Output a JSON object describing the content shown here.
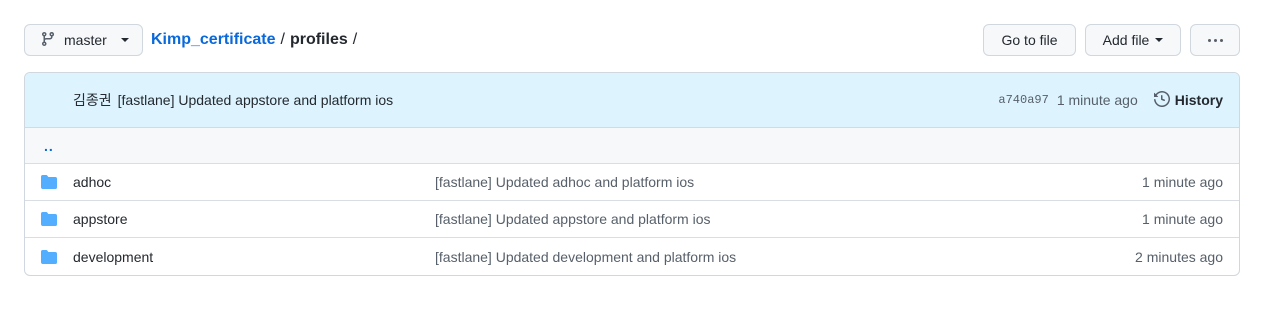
{
  "toolbar": {
    "branch": "master",
    "repo": "Kimp_certificate",
    "separator1": "/",
    "directory": "profiles",
    "separator2": "/",
    "goto_file": "Go to file",
    "add_file": "Add file"
  },
  "commit": {
    "author": "김종권",
    "message": "[fastlane] Updated appstore and platform ios",
    "sha": "a740a97",
    "time": "1 minute ago",
    "history_label": "History"
  },
  "parent_link": "..",
  "files": [
    {
      "name": "adhoc",
      "message": "[fastlane] Updated adhoc and platform ios",
      "time": "1 minute ago",
      "icon": "folder-icon"
    },
    {
      "name": "appstore",
      "message": "[fastlane] Updated appstore and platform ios",
      "time": "1 minute ago",
      "icon": "folder-icon"
    },
    {
      "name": "development",
      "message": "[fastlane] Updated development and platform ios",
      "time": "2 minutes ago",
      "icon": "folder-icon"
    }
  ],
  "colors": {
    "link": "#0969da",
    "commit_bar_bg": "#ddf4ff",
    "folder": "#54aeff"
  }
}
